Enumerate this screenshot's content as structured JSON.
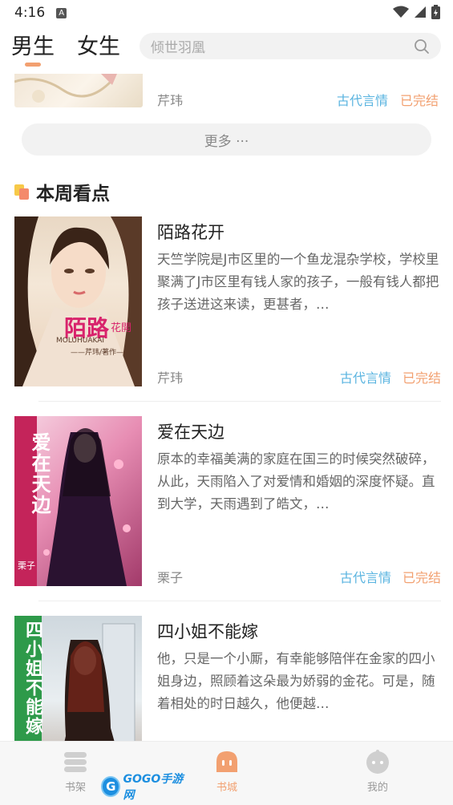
{
  "status_bar": {
    "time": "4:16",
    "notification_icon": "A"
  },
  "header": {
    "tabs": [
      {
        "label": "男生"
      },
      {
        "label": "女生"
      }
    ],
    "search_placeholder": "倾世羽凰"
  },
  "prev_item": {
    "author": "芹玮",
    "category": "古代言情",
    "status": "已完结"
  },
  "more_button": "更多 ···",
  "section": {
    "title": "本周看点"
  },
  "books": [
    {
      "title": "陌路花开",
      "description": "天竺学院是J市区里的一个鱼龙混杂学校，学校里聚满了J市区里有钱人家的孩子，一般有钱人都把孩子送进这来读，更甚者，…",
      "author": "芹玮",
      "category": "古代言情",
      "status": "已完结",
      "cover_text": {
        "title": "陌路",
        "sub": "花開",
        "pinyin": "MOLUHUAKAI",
        "byline": "——芹玮/著作——"
      }
    },
    {
      "title": "爱在天边",
      "description": "原本的幸福美满的家庭在国三的时候突然破碎，从此，天雨陷入了对爱情和婚姻的深度怀疑。直到大学，天雨遇到了皓文，…",
      "author": "栗子",
      "category": "古代言情",
      "status": "已完结",
      "cover_text": {
        "title": "爱在天边",
        "byline": "栗子"
      }
    },
    {
      "title": "四小姐不能嫁",
      "description": "他，只是一个小厮，有幸能够陪伴在金家的四小姐身边，照顾着这朵最为娇弱的金花。可是，随着相处的时日越久，他便越…",
      "cover_text": {
        "title": "四小姐不能嫁"
      }
    }
  ],
  "bottom_nav": {
    "items": [
      {
        "label": "书架",
        "icon": "bookshelf-icon"
      },
      {
        "label": "书城",
        "icon": "bookstore-icon"
      },
      {
        "label": "我的",
        "icon": "profile-icon"
      }
    ],
    "watermark": {
      "circle": "G",
      "text": "GOGO手游网"
    }
  },
  "colors": {
    "accent": "#f2a070",
    "category": "#5ab4e0"
  }
}
